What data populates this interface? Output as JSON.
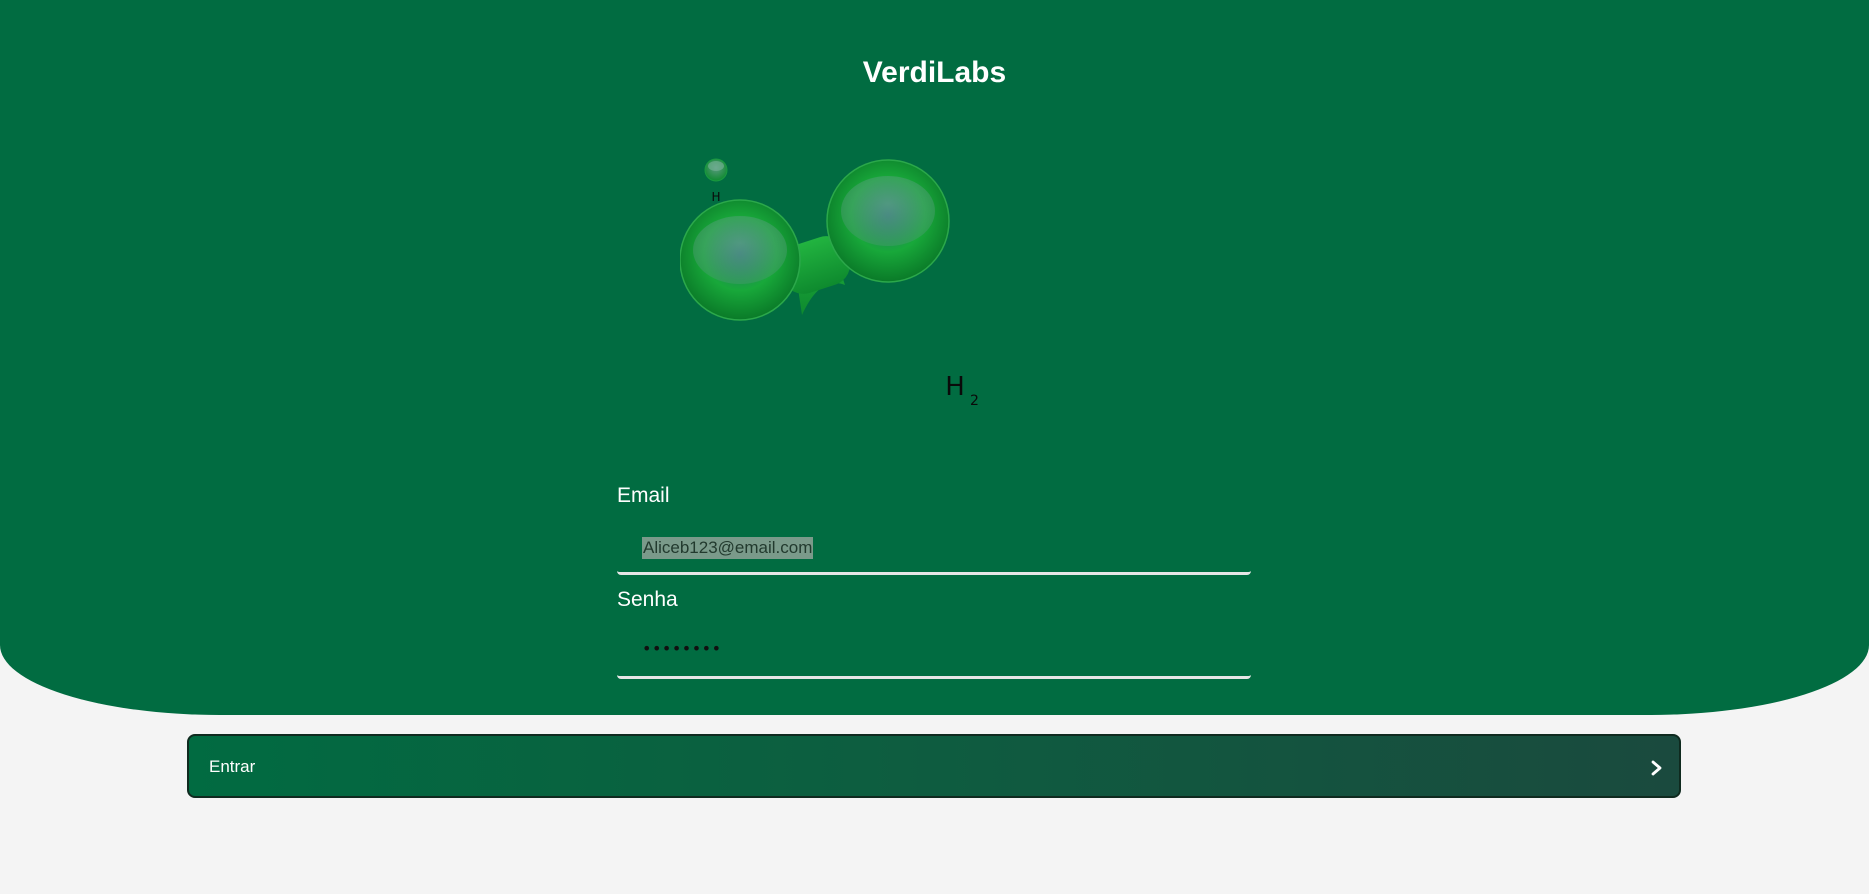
{
  "app": {
    "title": "VerdiLabs"
  },
  "molecule": {
    "small_atom_label": "H",
    "formula_symbol": "H",
    "formula_subscript": "2",
    "colors": {
      "atom_green": "#1fae3c",
      "atom_dark": "#0c7a2a",
      "atom_highlight": "#5aa07e"
    }
  },
  "form": {
    "email_label": "Email",
    "email_value": "Aliceb123@email.com",
    "password_label": "Senha",
    "password_value": "••••••••"
  },
  "actions": {
    "submit_label": "Entrar",
    "submit_icon": "chevron-right-icon"
  },
  "colors": {
    "hero_background": "#016c41",
    "page_background": "#f4f4f4"
  }
}
